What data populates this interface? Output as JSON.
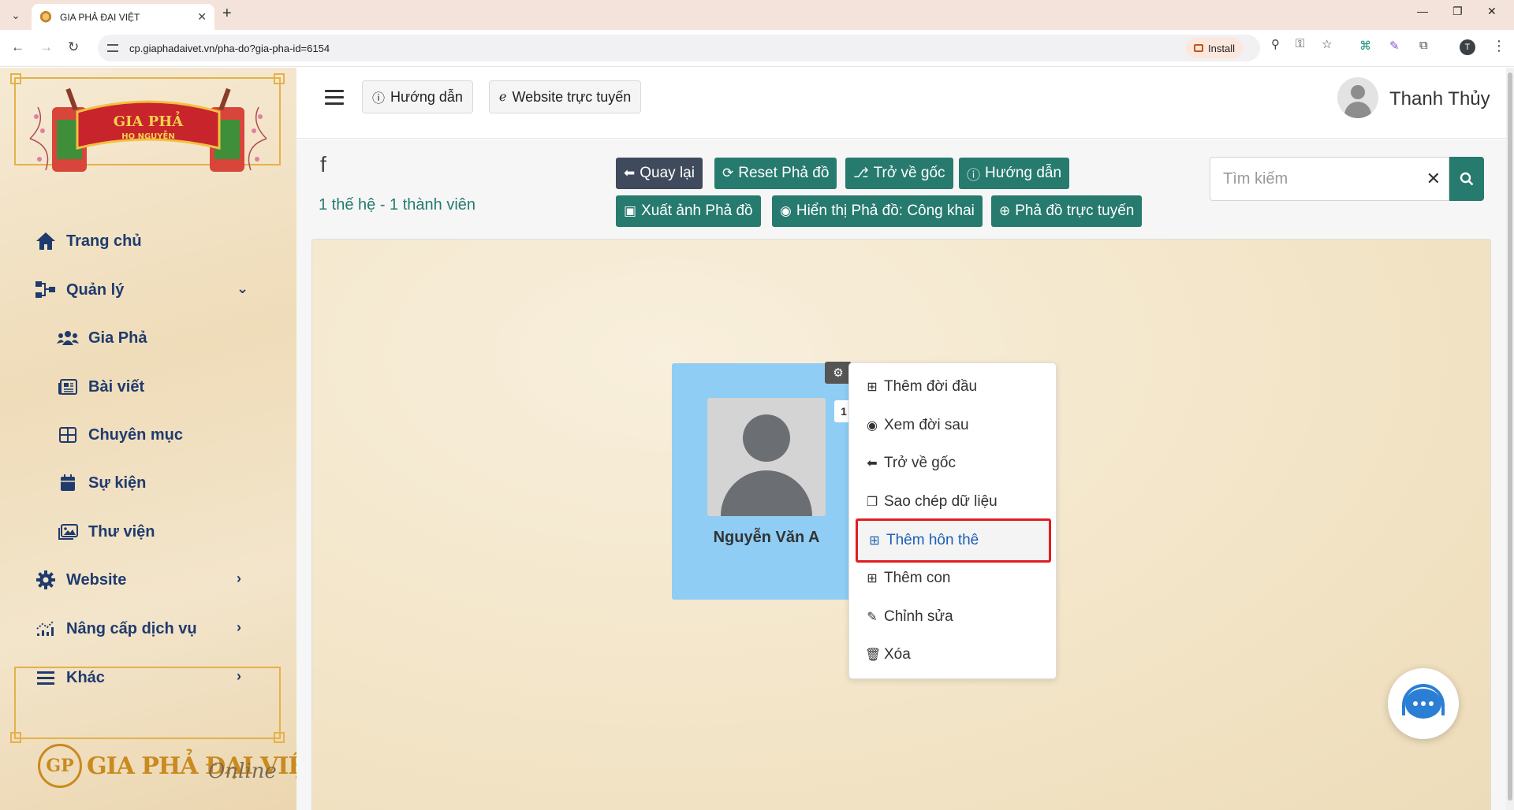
{
  "browser": {
    "tab_title": "GIA PHẢ ĐẠI VIỆT",
    "url": "cp.giaphadaivet.vn/pha-do?gia-pha-id=6154",
    "install_label": "Install",
    "profile_initial": "T"
  },
  "sidebar": {
    "logo_text": "GIA PHẢ",
    "logo_sub": "HỌ NGUYỄN",
    "items": [
      {
        "label": "Trang chủ"
      },
      {
        "label": "Quản lý"
      },
      {
        "label": "Gia Phả"
      },
      {
        "label": "Bài viết"
      },
      {
        "label": "Chuyên mục"
      },
      {
        "label": "Sự kiện"
      },
      {
        "label": "Thư viện"
      },
      {
        "label": "Website"
      },
      {
        "label": "Nâng cấp dịch vụ"
      },
      {
        "label": "Khác"
      }
    ],
    "brand_gp": "GP",
    "brand_name": "GIA PHẢ ĐẠI VIỆT",
    "brand_online": "Online"
  },
  "header": {
    "guide_label": "Hướng dẫn",
    "website_label": "Website trực tuyến",
    "username": "Thanh Thủy"
  },
  "main": {
    "tree_title": "f",
    "tree_summary": "1 thế hệ - 1 thành viên",
    "buttons": {
      "back": "Quay lại",
      "reset": "Reset Phả đồ",
      "root": "Trở về gốc",
      "guide": "Hướng dẫn",
      "export": "Xuất ảnh Phả đồ",
      "visibility": "Hiển thị Phả đồ: Công khai",
      "online": "Phả đồ trực tuyến"
    },
    "search_placeholder": "Tìm kiếm",
    "member": {
      "name": "Nguyễn Văn A",
      "generation_tag": "1"
    },
    "context_menu": [
      {
        "label": "Thêm đời đầu"
      },
      {
        "label": "Xem đời sau"
      },
      {
        "label": "Trở về gốc"
      },
      {
        "label": "Sao chép dữ liệu"
      },
      {
        "label": "Thêm hôn thê"
      },
      {
        "label": "Thêm con"
      },
      {
        "label": "Chỉnh sửa"
      },
      {
        "label": "Xóa"
      }
    ]
  },
  "colors": {
    "primary_green": "#267a6e",
    "sidebar_text": "#1f3b6e",
    "card_blue": "#8fcdf5",
    "highlight_red": "#e31b23"
  }
}
